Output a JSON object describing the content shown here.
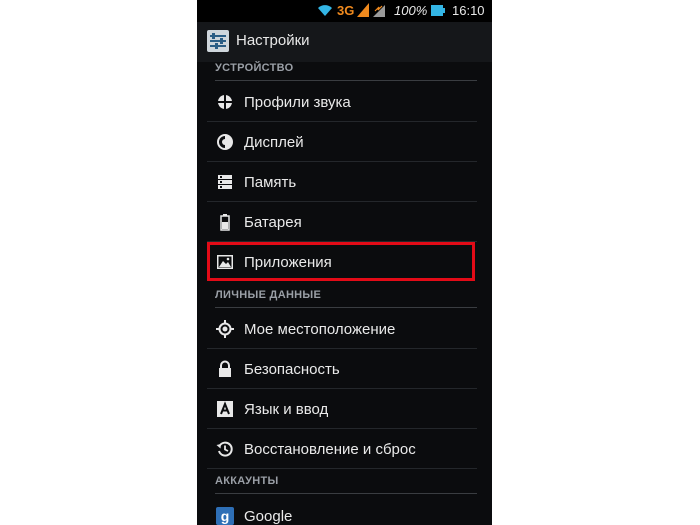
{
  "status_bar": {
    "network": "3G",
    "battery_percent": "100%",
    "time": "16:10",
    "wifi_icon": "wifi-icon",
    "signal_icon": "signal-icon",
    "battery_icon": "battery-icon"
  },
  "action_bar": {
    "title": "Настройки",
    "icon": "settings-sliders-icon"
  },
  "sections": {
    "device": "УСТРОЙСТВО",
    "personal": "ЛИЧНЫЕ ДАННЫЕ",
    "accounts": "АККАУНТЫ"
  },
  "items": {
    "sound_profiles": {
      "label": "Профили звука",
      "icon": "sound-profiles-icon"
    },
    "display": {
      "label": "Дисплей",
      "icon": "display-brightness-icon"
    },
    "memory": {
      "label": "Память",
      "icon": "storage-icon"
    },
    "battery": {
      "label": "Батарея",
      "icon": "battery-icon"
    },
    "apps": {
      "label": "Приложения",
      "icon": "apps-icon"
    },
    "location": {
      "label": "Мое местоположение",
      "icon": "location-icon"
    },
    "security": {
      "label": "Безопасность",
      "icon": "lock-icon"
    },
    "language": {
      "label": "Язык и ввод",
      "icon": "keyboard-letter-icon"
    },
    "backup": {
      "label": "Восстановление и сброс",
      "icon": "restore-icon"
    },
    "google": {
      "label": "Google",
      "icon": "google-icon"
    }
  },
  "colors": {
    "highlight": "#e30b17",
    "network_3g": "#f08a1e",
    "background": "#0b0c0e"
  }
}
